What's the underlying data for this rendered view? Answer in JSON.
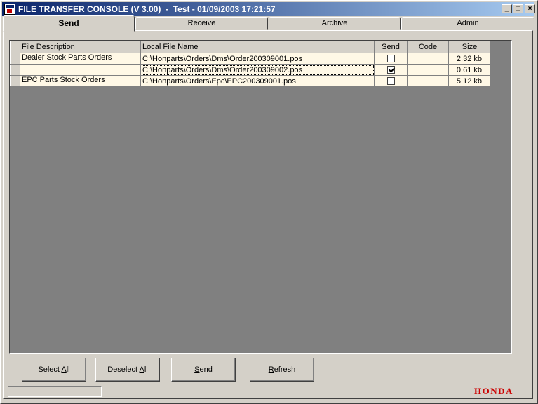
{
  "window": {
    "title": "FILE TRANSFER CONSOLE (V 3.00)  -  Test - 01/09/2003 17:21:57",
    "app_icon": "app-icon",
    "controls": {
      "minimize": "_",
      "maximize": "□",
      "close": "×"
    }
  },
  "tabs": [
    {
      "label": "Send",
      "active": true
    },
    {
      "label": "Receive",
      "active": false
    },
    {
      "label": "Archive",
      "active": false
    },
    {
      "label": "Admin",
      "active": false
    }
  ],
  "grid": {
    "columns": [
      "File Description",
      "Local File Name",
      "Send",
      "Code",
      "Size"
    ],
    "rows": [
      {
        "description": "Dealer Stock Parts Orders",
        "file": "C:\\Honparts\\Orders\\Dms\\Order200309001.pos",
        "send": false,
        "code": "",
        "size": "2.32 kb"
      },
      {
        "description": "",
        "file": "C:\\Honparts\\Orders\\Dms\\Order200309002.pos",
        "send": true,
        "code": "",
        "size": "0.61 kb"
      },
      {
        "description": "EPC Parts Stock Orders",
        "file": "C:\\Honparts\\Orders\\Epc\\EPC200309001.pos",
        "send": false,
        "code": "",
        "size": "5.12 kb"
      }
    ]
  },
  "buttons": {
    "select_all": {
      "pre": "Select ",
      "ul": "A",
      "post": "ll"
    },
    "deselect_all": {
      "pre": "Deselect ",
      "ul": "A",
      "post": "ll"
    },
    "send": {
      "pre": "",
      "ul": "S",
      "post": "end"
    },
    "refresh": {
      "pre": "",
      "ul": "R",
      "post": "efresh"
    }
  },
  "status": {
    "text": ""
  },
  "logo": "HONDA",
  "colors": {
    "title_start": "#0a246a",
    "title_end": "#a6caf0",
    "row_bg": "#fff8e6",
    "grid_bg": "#808080",
    "logo": "#cc0000"
  }
}
